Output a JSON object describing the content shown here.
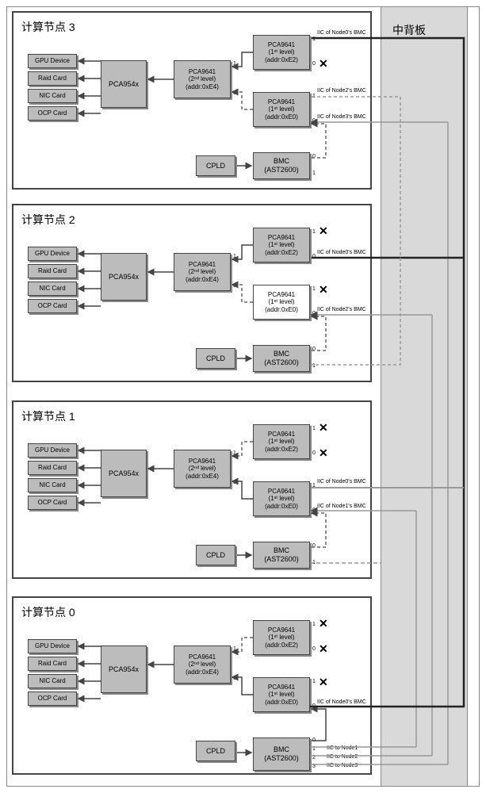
{
  "backplane": {
    "title": "中背板"
  },
  "devices": [
    "GPU Device",
    "Raid Card",
    "NIC Card",
    "OCP Card"
  ],
  "common": {
    "pca954x": "PCA954x",
    "l2_title": "PCA9641",
    "l2_sub": "(2ⁿᵈ level)",
    "l2_addr": "(addr:0xE4)",
    "l1_title": "PCA9641",
    "l1_sub": "(1ˢᵗ level)",
    "l1a_addr": "(addr:0xE2)",
    "l1b_addr": "(addr:0xE0)",
    "cpld": "CPLD",
    "bmc1": "BMC",
    "bmc2": "(AST2600)"
  },
  "nodes": {
    "n3": {
      "title": "计算节点 3",
      "labels": {
        "a1": "IIC of Node0's BMC",
        "b1": "IIC of Node2's BMC",
        "b0": "IIC of Node3's BMC"
      },
      "cross": {
        "a0": true,
        "a1": false,
        "b1": false,
        "b0": false
      }
    },
    "n2": {
      "title": "计算节点 2",
      "labels": {
        "a1": "IIC of Node0's BMC",
        "b0": "IIC of Node2's BMC"
      },
      "cross": {
        "a0": true,
        "a1": false,
        "b1": true,
        "b0": false
      }
    },
    "n1": {
      "title": "计算节点 1",
      "labels": {
        "b1": "IIC of Node0's BMC",
        "b0": "IIC of Node1's BMC"
      },
      "cross": {
        "a0": true,
        "a1": true,
        "b1": false,
        "b0": false
      }
    },
    "n0": {
      "title": "计算节点 0",
      "labels": {
        "b0": "IIC of Node0's BMC",
        "bmc1": "IIC to Node1",
        "bmc2": "IIC to Node2",
        "bmc3": "IIC to Node3"
      },
      "cross": {
        "a0": true,
        "a1": true,
        "b1": true,
        "b0": false
      }
    }
  }
}
